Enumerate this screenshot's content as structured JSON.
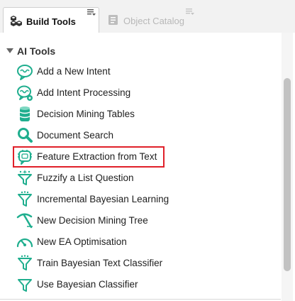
{
  "tabs": [
    {
      "label": "Build Tools",
      "active": true,
      "icon": "cubes-icon"
    },
    {
      "label": "Object Catalog",
      "active": false,
      "icon": "catalog-icon"
    }
  ],
  "tree": {
    "group": {
      "label": "AI Tools",
      "expanded": true
    },
    "items": [
      {
        "label": "Add a New Intent",
        "icon": "brain-speech-icon"
      },
      {
        "label": "Add Intent Processing",
        "icon": "brain-speech-gear-icon"
      },
      {
        "label": "Decision Mining Tables",
        "icon": "database-icon"
      },
      {
        "label": "Document Search",
        "icon": "magnifier-icon"
      },
      {
        "label": "Feature Extraction from Text",
        "icon": "chip-speech-icon",
        "highlighted": true
      },
      {
        "label": "Fuzzify a List Question",
        "icon": "funnel-sparkle-icon"
      },
      {
        "label": "Incremental Bayesian Learning",
        "icon": "funnel-icon"
      },
      {
        "label": "New Decision Mining Tree",
        "icon": "pickaxe-icon"
      },
      {
        "label": "New EA Optimisation",
        "icon": "gauge-icon"
      },
      {
        "label": "Train Bayesian Text Classifier",
        "icon": "funnel-icon"
      },
      {
        "label": "Use Bayesian Classifier",
        "icon": "funnel-icon"
      }
    ]
  },
  "colors": {
    "icon": "#1fae8e",
    "highlight": "#e0202a",
    "tab_active_text": "#111111",
    "tab_inactive_text": "#b8b8b8"
  }
}
